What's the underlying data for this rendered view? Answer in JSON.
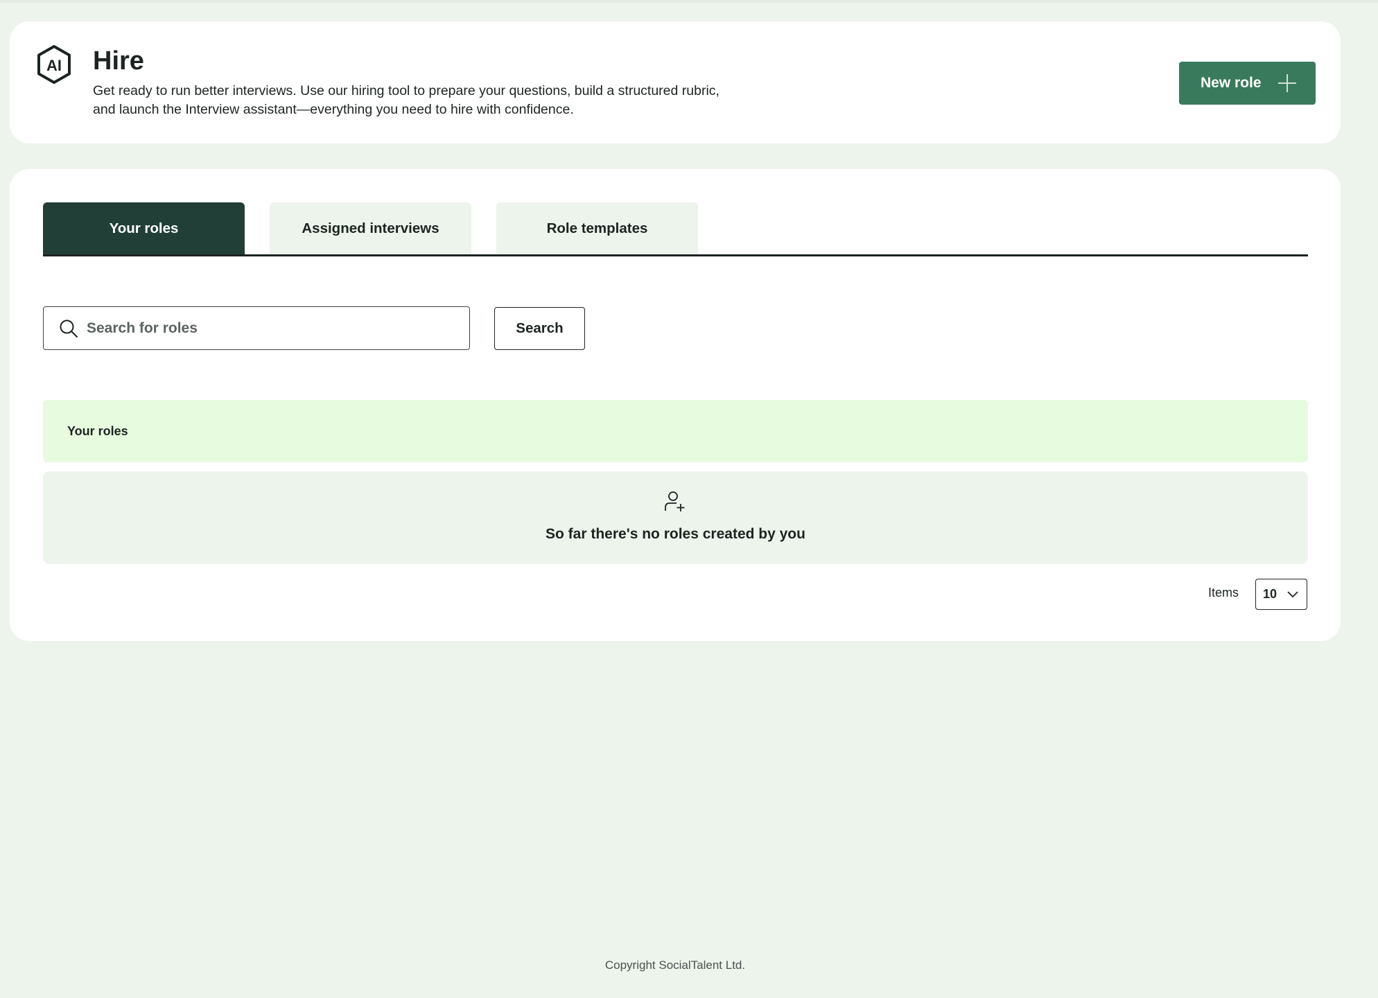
{
  "header": {
    "logo_text": "AI",
    "title": "Hire",
    "description": "Get ready to run better interviews. Use our hiring tool to prepare your questions, build a structured rubric, and launch the Interview assistant—everything you need to hire with confidence.",
    "new_role_label": "New role",
    "new_role_icon": "plus-icon"
  },
  "tabs": [
    {
      "label": "Your roles",
      "active": true
    },
    {
      "label": "Assigned interviews",
      "active": false
    },
    {
      "label": "Role templates",
      "active": false
    }
  ],
  "search": {
    "placeholder": "Search for roles",
    "value": "",
    "button_label": "Search",
    "icon": "search-icon"
  },
  "roles_section": {
    "banner_label": "Your roles",
    "empty_icon": "user-plus-icon",
    "empty_message": "So far there's no roles created by you"
  },
  "pagination": {
    "items_label": "Items",
    "items_per_page": "10"
  },
  "footer": {
    "copyright": "Copyright SocialTalent Ltd."
  },
  "colors": {
    "background": "#edf4ec",
    "primary_button": "#3a7a5c",
    "active_tab": "#213f37",
    "banner": "#e7fbdf"
  }
}
